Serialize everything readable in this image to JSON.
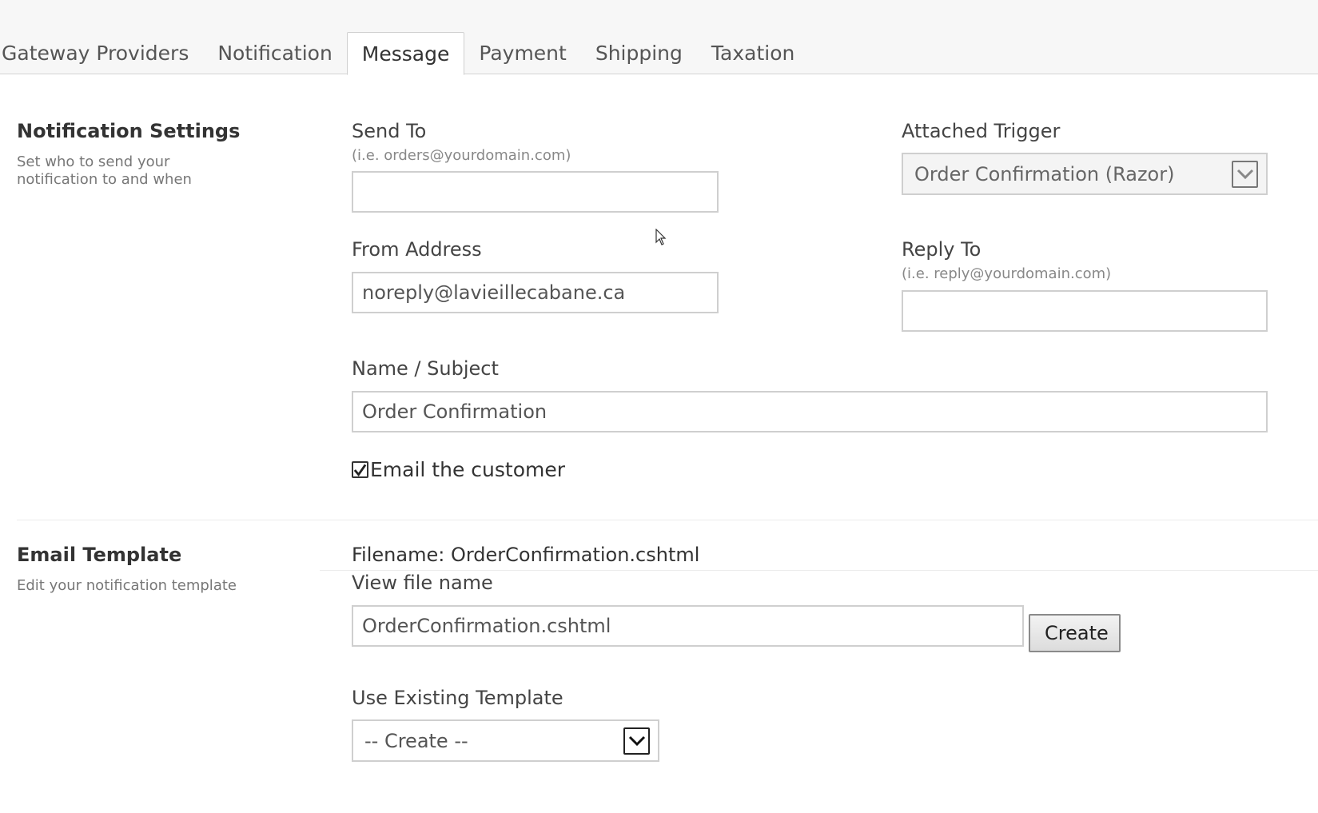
{
  "tabs": [
    {
      "label": "Gateway Providers",
      "active": false
    },
    {
      "label": "Notification",
      "active": false
    },
    {
      "label": "Message",
      "active": true
    },
    {
      "label": "Payment",
      "active": false
    },
    {
      "label": "Shipping",
      "active": false
    },
    {
      "label": "Taxation",
      "active": false
    }
  ],
  "notification_settings": {
    "title": "Notification Settings",
    "description": "Set who to send your notification to and when",
    "send_to": {
      "label": "Send To",
      "hint": "(i.e. orders@yourdomain.com)",
      "value": ""
    },
    "attached_trigger": {
      "label": "Attached Trigger",
      "value": "Order Confirmation (Razor)"
    },
    "from_address": {
      "label": "From Address",
      "value": "noreply@lavieillecabane.ca"
    },
    "reply_to": {
      "label": "Reply To",
      "hint": "(i.e. reply@yourdomain.com)",
      "value": ""
    },
    "subject": {
      "label": "Name / Subject",
      "value": "Order Confirmation"
    },
    "email_customer": {
      "label": "Email the customer",
      "checked": true
    }
  },
  "email_template": {
    "title": "Email Template",
    "description": "Edit your notification template",
    "filename_text": "Filename: OrderConfirmation.cshtml",
    "view_file_name": {
      "label": "View file name",
      "value": "OrderConfirmation.cshtml"
    },
    "create_button": "Create",
    "existing_template": {
      "label": "Use Existing Template",
      "value": "-- Create --"
    }
  }
}
